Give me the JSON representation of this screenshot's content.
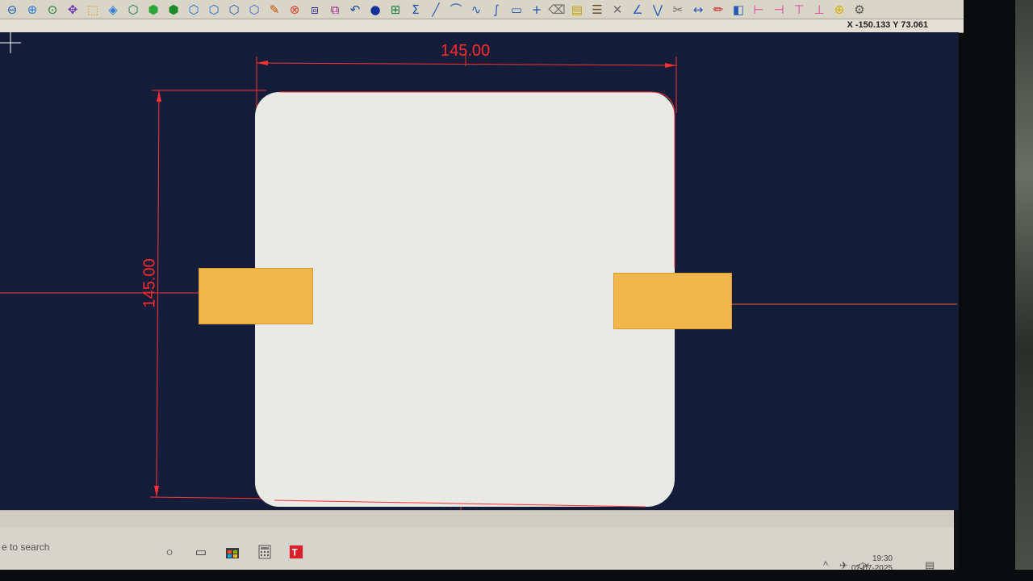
{
  "toolbar": {
    "icons": [
      "zoom-out-icon",
      "zoom-in-icon",
      "zoom-window-icon",
      "pan-icon",
      "select-icon",
      "3d-view-icon",
      "cube-wire-icon",
      "cube-green-icon",
      "cube-solid-icon",
      "cube-blue-icon",
      "cube-top-icon",
      "cube-front-icon",
      "cube-iso-icon",
      "measure-icon",
      "snap-icon",
      "align-icon",
      "mirror-icon",
      "undo-icon",
      "sphere-icon",
      "grid-icon",
      "sum-icon",
      "line-icon",
      "arc-icon",
      "curve-icon",
      "spline-icon",
      "rectangle-icon",
      "plus-icon",
      "erase-icon",
      "box-icon",
      "layers-icon",
      "cross-icon",
      "angle-icon",
      "chevron-icon",
      "trim-icon",
      "extend-icon",
      "pen-icon",
      "fill-icon",
      "dimension-icon",
      "dimension-2-icon",
      "dimension-3-icon",
      "dimension-4-icon",
      "crosshair-icon",
      "settings-icon"
    ]
  },
  "status": {
    "coordinates": "X -150.133   Y 73.061"
  },
  "drawing": {
    "width_dimension": "145.00",
    "height_dimension": "145.00"
  },
  "taskbar": {
    "search_placeholder": "e to search",
    "time": "19:30",
    "date": "07-07-2025"
  },
  "colors": {
    "canvas": "#131d3a",
    "dimension": "#ff2a2a",
    "plate": "#e9e9e6",
    "tab": "#f0b84c"
  }
}
